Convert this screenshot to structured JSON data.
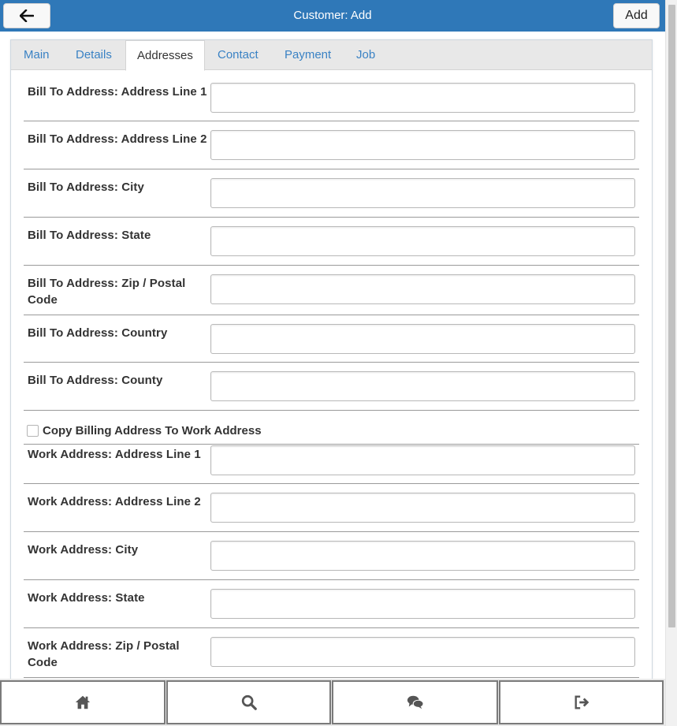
{
  "header": {
    "title": "Customer: Add",
    "back_icon": "arrow-left-icon",
    "add_label": "Add",
    "color": "#2f78b8"
  },
  "tabs": [
    {
      "label": "Main",
      "active": false
    },
    {
      "label": "Details",
      "active": false
    },
    {
      "label": "Addresses",
      "active": true
    },
    {
      "label": "Contact",
      "active": false
    },
    {
      "label": "Payment",
      "active": false
    },
    {
      "label": "Job",
      "active": false
    }
  ],
  "bill_fields": [
    {
      "label": "Bill To Address: Address Line 1",
      "value": ""
    },
    {
      "label": "Bill To Address: Address Line 2",
      "value": ""
    },
    {
      "label": "Bill To Address: City",
      "value": ""
    },
    {
      "label": "Bill To Address: State",
      "value": ""
    },
    {
      "label": "Bill To Address: Zip / Postal Code",
      "value": ""
    },
    {
      "label": "Bill To Address: Country",
      "value": ""
    },
    {
      "label": "Bill To Address: County",
      "value": ""
    }
  ],
  "copy_checkbox": {
    "label": "Copy Billing Address To Work Address",
    "checked": false
  },
  "work_fields": [
    {
      "label": "Work Address: Address Line 1",
      "value": ""
    },
    {
      "label": "Work Address: Address Line 2",
      "value": ""
    },
    {
      "label": "Work Address: City",
      "value": ""
    },
    {
      "label": "Work Address: State",
      "value": ""
    },
    {
      "label": "Work Address: Zip / Postal Code",
      "value": ""
    }
  ],
  "footer": {
    "buttons": [
      {
        "icon": "home-icon"
      },
      {
        "icon": "search-icon"
      },
      {
        "icon": "chat-icon"
      },
      {
        "icon": "sign-out-icon"
      }
    ]
  }
}
